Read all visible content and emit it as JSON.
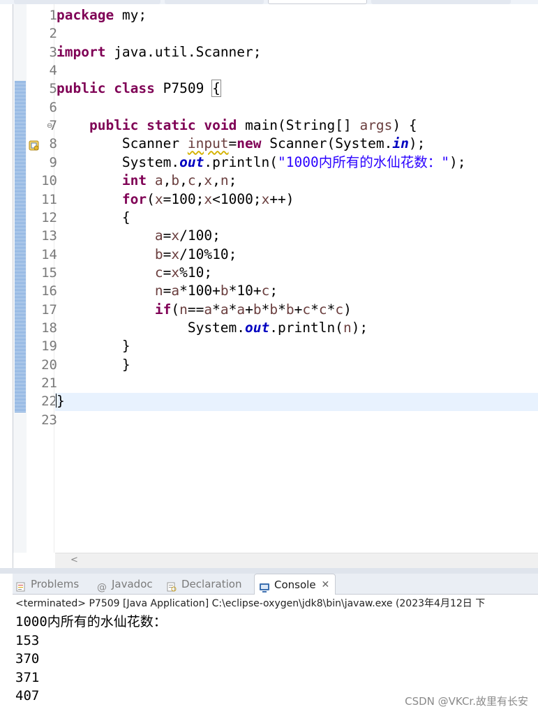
{
  "editor": {
    "lines": [
      {
        "n": "1",
        "tokens": [
          {
            "t": "package",
            "c": "kw"
          },
          {
            "t": " my;"
          }
        ]
      },
      {
        "n": "2",
        "tokens": []
      },
      {
        "n": "3",
        "tokens": [
          {
            "t": "import",
            "c": "kw"
          },
          {
            "t": " java.util.Scanner;"
          }
        ]
      },
      {
        "n": "4",
        "tokens": []
      },
      {
        "n": "5",
        "tokens": [
          {
            "t": "public",
            "c": "kw"
          },
          {
            "t": " "
          },
          {
            "t": "class",
            "c": "kw"
          },
          {
            "t": " P7509 "
          },
          {
            "t": "{",
            "c": "brace-box"
          }
        ]
      },
      {
        "n": "6",
        "tokens": []
      },
      {
        "n": "7",
        "tokens": [
          {
            "t": "    "
          },
          {
            "t": "public",
            "c": "kw"
          },
          {
            "t": " "
          },
          {
            "t": "static",
            "c": "kw"
          },
          {
            "t": " "
          },
          {
            "t": "void",
            "c": "kw"
          },
          {
            "t": " main(String[] "
          },
          {
            "t": "args",
            "c": "loc"
          },
          {
            "t": ") {"
          }
        ]
      },
      {
        "n": "8",
        "tokens": [
          {
            "t": "        Scanner "
          },
          {
            "t": "input",
            "c": "loc warn-ul"
          },
          {
            "t": "="
          },
          {
            "t": "new",
            "c": "kw"
          },
          {
            "t": " Scanner(System."
          },
          {
            "t": "in",
            "c": "fld"
          },
          {
            "t": ");"
          }
        ]
      },
      {
        "n": "9",
        "tokens": [
          {
            "t": "        System."
          },
          {
            "t": "out",
            "c": "fld"
          },
          {
            "t": ".println("
          },
          {
            "t": "\"1000内所有的水仙花数：\"",
            "c": "str"
          },
          {
            "t": ");"
          }
        ]
      },
      {
        "n": "10",
        "tokens": [
          {
            "t": "        "
          },
          {
            "t": "int",
            "c": "kw"
          },
          {
            "t": " "
          },
          {
            "t": "a",
            "c": "loc"
          },
          {
            "t": ","
          },
          {
            "t": "b",
            "c": "loc"
          },
          {
            "t": ","
          },
          {
            "t": "c",
            "c": "loc"
          },
          {
            "t": ","
          },
          {
            "t": "x",
            "c": "loc"
          },
          {
            "t": ","
          },
          {
            "t": "n",
            "c": "loc"
          },
          {
            "t": ";"
          }
        ]
      },
      {
        "n": "11",
        "tokens": [
          {
            "t": "        "
          },
          {
            "t": "for",
            "c": "kw"
          },
          {
            "t": "("
          },
          {
            "t": "x",
            "c": "loc"
          },
          {
            "t": "=100;"
          },
          {
            "t": "x",
            "c": "loc"
          },
          {
            "t": "<1000;"
          },
          {
            "t": "x",
            "c": "loc"
          },
          {
            "t": "++)"
          }
        ]
      },
      {
        "n": "12",
        "tokens": [
          {
            "t": "        {"
          }
        ]
      },
      {
        "n": "13",
        "tokens": [
          {
            "t": "            "
          },
          {
            "t": "a",
            "c": "loc"
          },
          {
            "t": "="
          },
          {
            "t": "x",
            "c": "loc"
          },
          {
            "t": "/100;"
          }
        ]
      },
      {
        "n": "14",
        "tokens": [
          {
            "t": "            "
          },
          {
            "t": "b",
            "c": "loc"
          },
          {
            "t": "="
          },
          {
            "t": "x",
            "c": "loc"
          },
          {
            "t": "/10%10;"
          }
        ]
      },
      {
        "n": "15",
        "tokens": [
          {
            "t": "            "
          },
          {
            "t": "c",
            "c": "loc"
          },
          {
            "t": "="
          },
          {
            "t": "x",
            "c": "loc"
          },
          {
            "t": "%10;"
          }
        ]
      },
      {
        "n": "16",
        "tokens": [
          {
            "t": "            "
          },
          {
            "t": "n",
            "c": "loc"
          },
          {
            "t": "="
          },
          {
            "t": "a",
            "c": "loc"
          },
          {
            "t": "*100+"
          },
          {
            "t": "b",
            "c": "loc"
          },
          {
            "t": "*10+"
          },
          {
            "t": "c",
            "c": "loc"
          },
          {
            "t": ";"
          }
        ]
      },
      {
        "n": "17",
        "tokens": [
          {
            "t": "            "
          },
          {
            "t": "if",
            "c": "kw"
          },
          {
            "t": "("
          },
          {
            "t": "n",
            "c": "loc"
          },
          {
            "t": "=="
          },
          {
            "t": "a",
            "c": "loc"
          },
          {
            "t": "*"
          },
          {
            "t": "a",
            "c": "loc"
          },
          {
            "t": "*"
          },
          {
            "t": "a",
            "c": "loc"
          },
          {
            "t": "+"
          },
          {
            "t": "b",
            "c": "loc"
          },
          {
            "t": "*"
          },
          {
            "t": "b",
            "c": "loc"
          },
          {
            "t": "*"
          },
          {
            "t": "b",
            "c": "loc"
          },
          {
            "t": "+"
          },
          {
            "t": "c",
            "c": "loc"
          },
          {
            "t": "*"
          },
          {
            "t": "c",
            "c": "loc"
          },
          {
            "t": "*"
          },
          {
            "t": "c",
            "c": "loc"
          },
          {
            "t": ")"
          }
        ]
      },
      {
        "n": "18",
        "tokens": [
          {
            "t": "                System."
          },
          {
            "t": "out",
            "c": "fld"
          },
          {
            "t": ".println("
          },
          {
            "t": "n",
            "c": "loc"
          },
          {
            "t": ");"
          }
        ]
      },
      {
        "n": "19",
        "tokens": [
          {
            "t": "        }"
          }
        ]
      },
      {
        "n": "20",
        "tokens": [
          {
            "t": "        }"
          }
        ]
      },
      {
        "n": "21",
        "tokens": []
      },
      {
        "n": "22",
        "tokens": [
          {
            "t": "}",
            "c": "caret-before"
          }
        ]
      },
      {
        "n": "23",
        "tokens": []
      }
    ],
    "scroll_arrow": "<"
  },
  "views": {
    "tabs": [
      {
        "label": "Problems",
        "icon": "problems-icon",
        "active": false
      },
      {
        "label": "Javadoc",
        "icon": "javadoc-icon",
        "active": false
      },
      {
        "label": "Declaration",
        "icon": "declaration-icon",
        "active": false
      },
      {
        "label": "Console",
        "icon": "console-icon",
        "active": true
      }
    ],
    "close_glyph": "✕"
  },
  "console": {
    "status": "<terminated> P7509 [Java Application] C:\\eclipse-oxygen\\jdk8\\bin\\javaw.exe (2023年4月12日 下",
    "output": [
      "1000内所有的水仙花数：",
      "153",
      "370",
      "371",
      "407"
    ]
  },
  "watermark": "CSDN @VKCr.故里有长安",
  "colors": {
    "keyword": "#7f0055",
    "string": "#2a00ff",
    "field": "#0000c0",
    "local_var": "#6a3e3e",
    "current_line": "#e8f2fe"
  }
}
